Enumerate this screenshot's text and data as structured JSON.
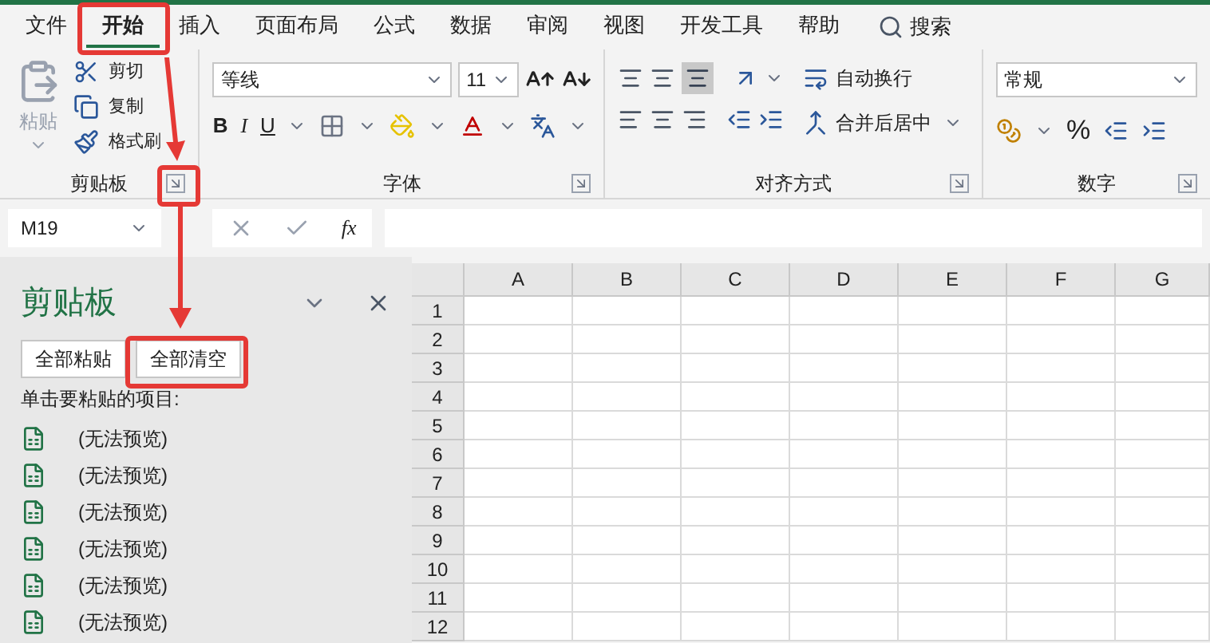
{
  "tabs": [
    {
      "label": "文件",
      "selected": false
    },
    {
      "label": "开始",
      "selected": true
    },
    {
      "label": "插入",
      "selected": false
    },
    {
      "label": "页面布局",
      "selected": false
    },
    {
      "label": "公式",
      "selected": false
    },
    {
      "label": "数据",
      "selected": false
    },
    {
      "label": "审阅",
      "selected": false
    },
    {
      "label": "视图",
      "selected": false
    },
    {
      "label": "开发工具",
      "selected": false
    },
    {
      "label": "帮助",
      "selected": false
    }
  ],
  "search": {
    "label": "搜索"
  },
  "ribbon": {
    "clipboard": {
      "paste_label": "粘贴",
      "items": [
        "剪切",
        "复制",
        "格式刷"
      ],
      "title": "剪贴板"
    },
    "font": {
      "font_name": "等线",
      "font_size": "11",
      "style_buttons": [
        "B",
        "I",
        "U"
      ],
      "title": "字体"
    },
    "alignment": {
      "wrap_label": "自动换行",
      "merge_label": "合并后居中",
      "title": "对齐方式"
    },
    "number": {
      "format": "常规",
      "percent": "%",
      "title": "数字"
    }
  },
  "formula_bar": {
    "name_box": "M19",
    "fx_label": "fx"
  },
  "clipboard_pane": {
    "title": "剪贴板",
    "buttons": [
      "全部粘贴",
      "全部清空"
    ],
    "instruction": "单击要粘贴的项目:",
    "items": [
      "(无法预览)",
      "(无法预览)",
      "(无法预览)",
      "(无法预览)",
      "(无法预览)",
      "(无法预览)"
    ]
  },
  "sheet": {
    "columns": [
      "A",
      "B",
      "C",
      "D",
      "E",
      "F",
      "G"
    ],
    "rows": [
      "1",
      "2",
      "3",
      "4",
      "5",
      "6",
      "7",
      "8",
      "9",
      "10",
      "11",
      "12"
    ]
  }
}
